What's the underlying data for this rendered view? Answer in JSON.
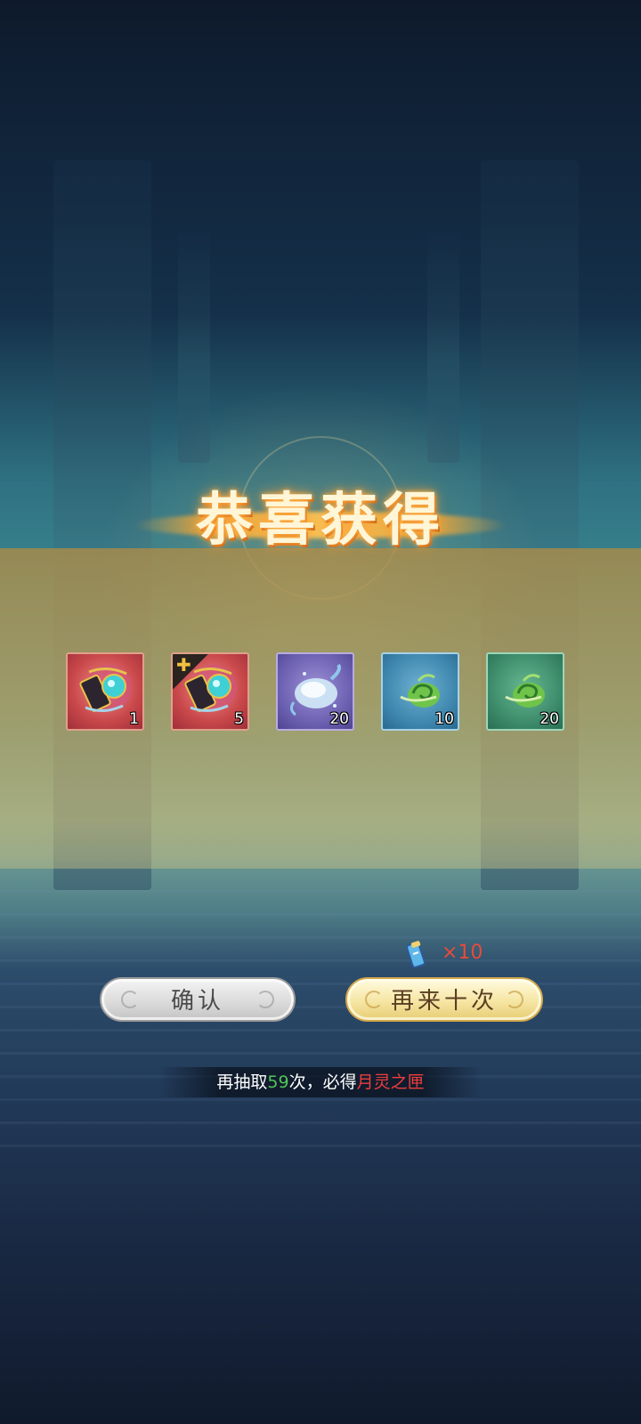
{
  "reward_popup": {
    "title": "恭喜获得",
    "items": [
      {
        "name": "moon-spirit-box",
        "count": "1",
        "frame": "red",
        "is_fragment": false
      },
      {
        "name": "moon-spirit-box-fragment",
        "count": "5",
        "frame": "red",
        "is_fragment": true
      },
      {
        "name": "water-crystal",
        "count": "20",
        "frame": "purple",
        "is_fragment": false
      },
      {
        "name": "jade-cloud",
        "count": "10",
        "frame": "blue",
        "is_fragment": false
      },
      {
        "name": "jade-cloud",
        "count": "20",
        "frame": "green",
        "is_fragment": false
      }
    ]
  },
  "cost": {
    "icon": "draw-ticket-icon",
    "text": "×10"
  },
  "buttons": {
    "confirm_label": "确认",
    "again_label": "再来十次"
  },
  "pity": {
    "prefix": "再抽取",
    "count": "59",
    "middle": "次，必得",
    "item": "月灵之匣"
  },
  "colors": {
    "cost_text": "#e84a3a",
    "pity_count": "#52c35a",
    "pity_item": "#ee3d3d",
    "title_glow": "#ffb347"
  }
}
